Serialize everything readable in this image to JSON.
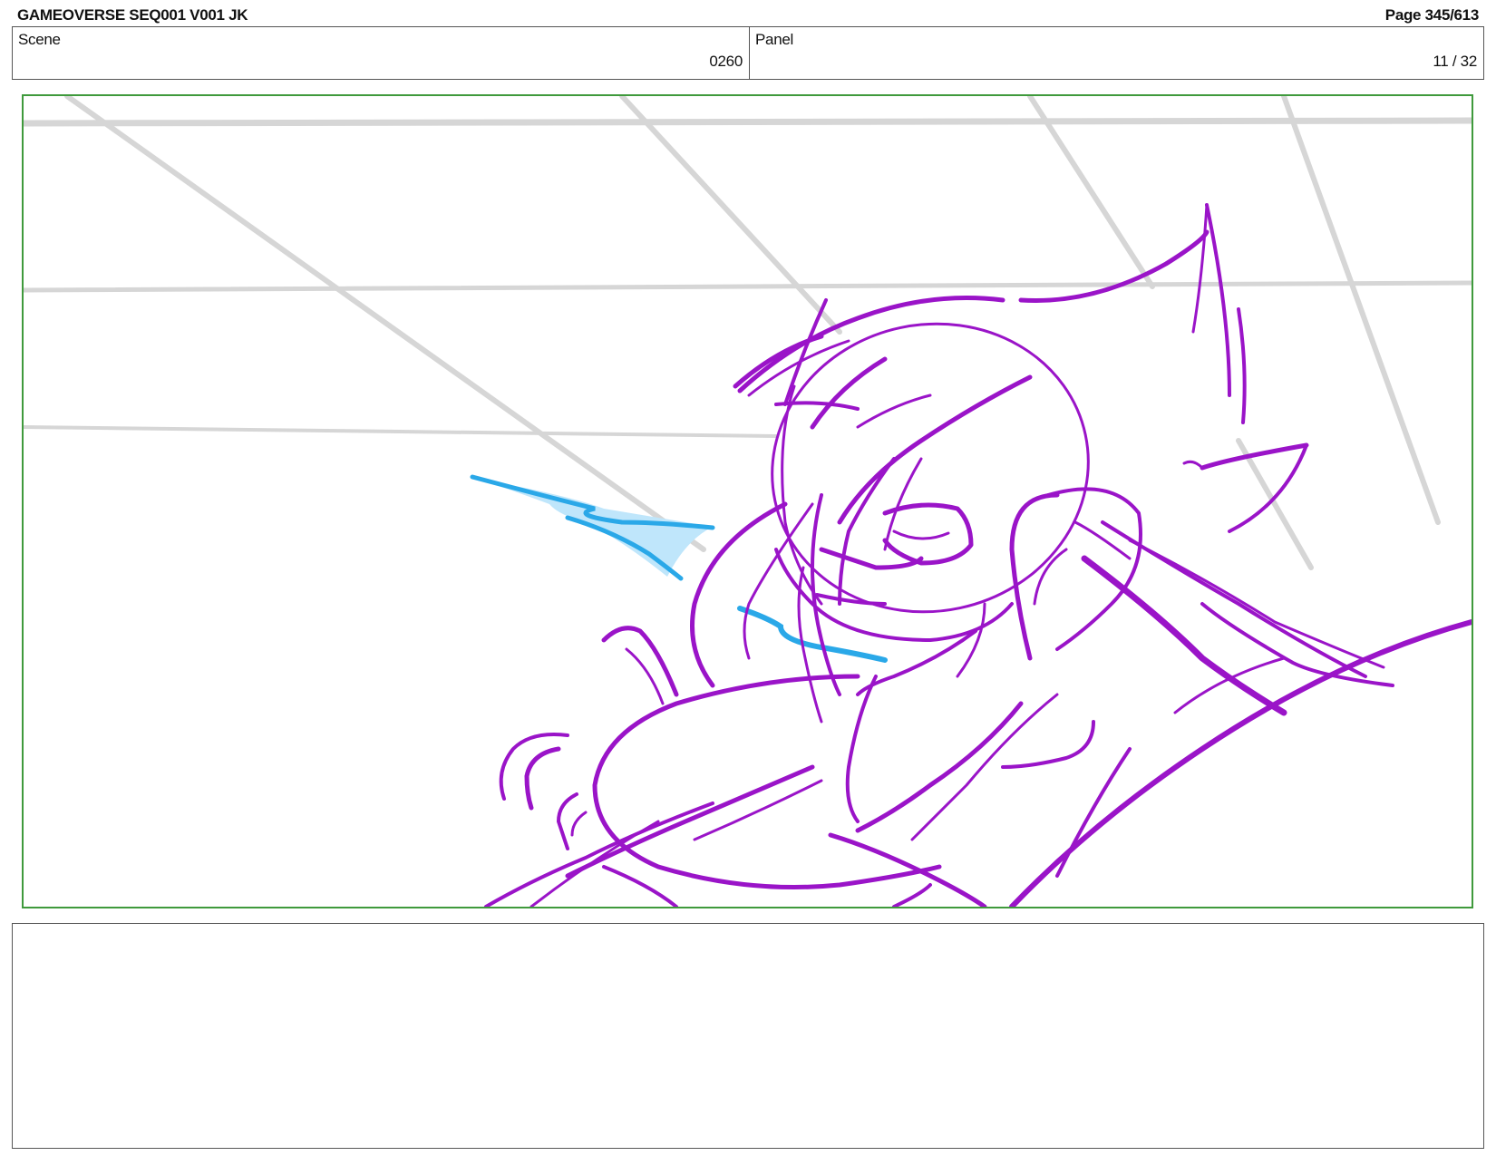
{
  "header": {
    "title": "GAMEOVERSE SEQ001 V001 JK",
    "page": "Page 345/613"
  },
  "info": {
    "scene_label": "Scene",
    "scene_value": "0260",
    "panel_label": "Panel",
    "panel_value": "11 / 32"
  },
  "colors": {
    "frame_border": "#3f9a3c",
    "sketch_lines": "#9a14c8",
    "effect_lines": "#2aa8e8",
    "effect_fill": "#bfe6fb",
    "background_grid": "#d6d6d6"
  },
  "notes": {
    "text": ""
  }
}
